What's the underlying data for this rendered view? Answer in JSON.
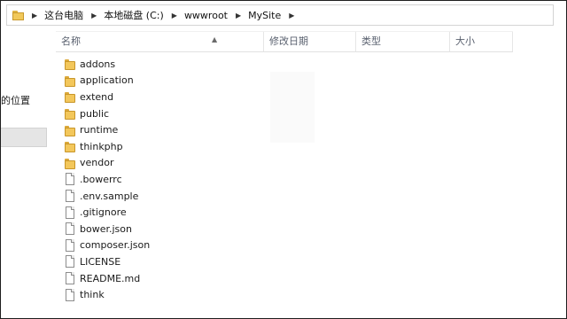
{
  "address_bar": {
    "crumbs": [
      {
        "label": "这台电脑"
      },
      {
        "label": "本地磁盘 (C:)"
      },
      {
        "label": "wwwroot"
      },
      {
        "label": "MySite"
      }
    ]
  },
  "columns": {
    "name": "名称",
    "date_modified": "修改日期",
    "type": "类型",
    "size": "大小"
  },
  "nav": {
    "partial_label": "的位置"
  },
  "files": [
    {
      "name": "addons",
      "kind": "folder"
    },
    {
      "name": "application",
      "kind": "folder"
    },
    {
      "name": "extend",
      "kind": "folder"
    },
    {
      "name": "public",
      "kind": "folder"
    },
    {
      "name": "runtime",
      "kind": "folder"
    },
    {
      "name": "thinkphp",
      "kind": "folder"
    },
    {
      "name": "vendor",
      "kind": "folder"
    },
    {
      "name": ".bowerrc",
      "kind": "file"
    },
    {
      "name": ".env.sample",
      "kind": "file"
    },
    {
      "name": ".gitignore",
      "kind": "file"
    },
    {
      "name": "bower.json",
      "kind": "file"
    },
    {
      "name": "composer.json",
      "kind": "file"
    },
    {
      "name": "LICENSE",
      "kind": "file"
    },
    {
      "name": "README.md",
      "kind": "file"
    },
    {
      "name": "think",
      "kind": "file"
    }
  ]
}
